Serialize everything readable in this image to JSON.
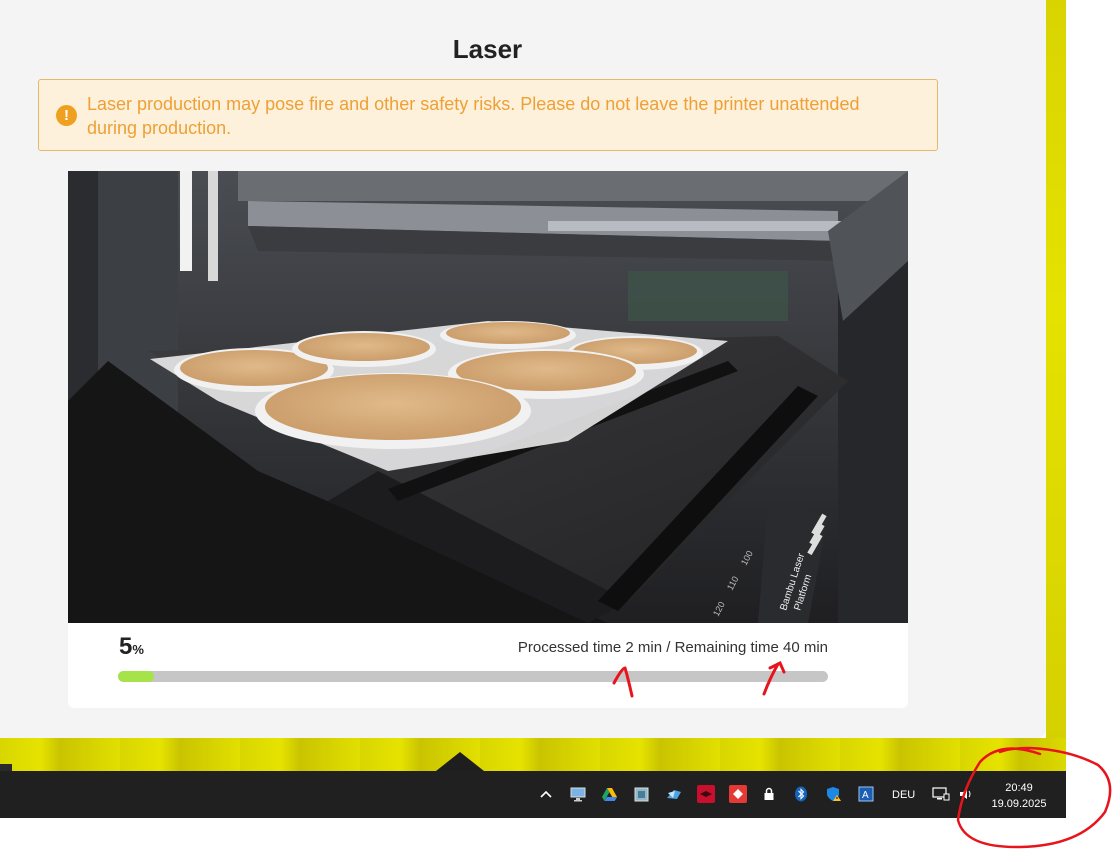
{
  "dialog": {
    "title": "Laser",
    "warning_text": "Laser production may pose fire and other safety risks. Please do not leave the printer unattended during production.",
    "warning_icon": "warning-circle-icon"
  },
  "camera": {
    "plate_label_1": "Bambu Laser",
    "plate_label_2": "Platform",
    "ruler_labels": [
      "120",
      "110",
      "100"
    ]
  },
  "progress": {
    "percent_value": "5",
    "percent_unit": "%",
    "fraction": 0.05,
    "time_text": "Processed time 2 min / Remaining time 40 min"
  },
  "taskbar": {
    "language": "DEU",
    "time": "20:49",
    "date": "19.09.2025",
    "tray_icons": [
      "chevron-up-icon",
      "monitor-icon",
      "google-drive-icon",
      "app-icon",
      "onedrive-icon",
      "red-app-icon",
      "red-app-icon-2",
      "lock-icon",
      "bluetooth-icon",
      "shield-icon",
      "font-icon",
      "network-icon",
      "speaker-icon"
    ]
  },
  "colors": {
    "warning_bg": "#fdf1dc",
    "warning_text": "#eea035",
    "progress_fill": "#a6e24a",
    "annotation": "#e8141c"
  }
}
